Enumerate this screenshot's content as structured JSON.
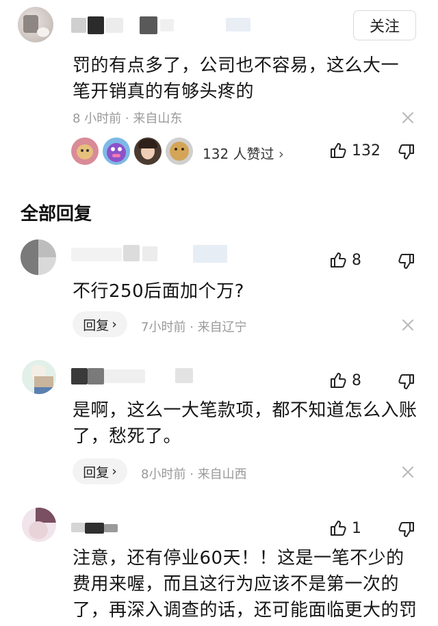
{
  "top_comment": {
    "follow_label": "关注",
    "text": "罚的有点多了，公司也不容易，这么大一笔开销真的有够头疼的",
    "text_line1": "罚的有点多了，公司也不容易，这么大一",
    "text_line2": "笔开销真的有够头疼的",
    "time": "8 小时前",
    "location": "来自山东",
    "likers_text": "132 人赞过",
    "like_count": "132"
  },
  "replies_section_title": "全部回复",
  "replies": [
    {
      "text": "不行250后面加个万?",
      "reply_label": "回复",
      "time": "7小时前",
      "location": "来自辽宁",
      "like_count": "8"
    },
    {
      "text_line1": "是啊，这么一大笔款项，都不知道怎么入账",
      "text_line2": "了，愁死了。",
      "reply_label": "回复",
      "time": "8小时前",
      "location": "来自山西",
      "like_count": "8"
    },
    {
      "text_line1": "注意，还有停业60天！！这是一笔不少的",
      "text_line2": "费用来喔，而且这行为应该不是第一次的",
      "text_line3": "了，再深入调查的话，还可能面临更大的罚",
      "like_count": "1"
    }
  ],
  "colors": {
    "meta_gray": "#999999",
    "text": "#161616",
    "pill_bg": "#f3f3f3"
  }
}
